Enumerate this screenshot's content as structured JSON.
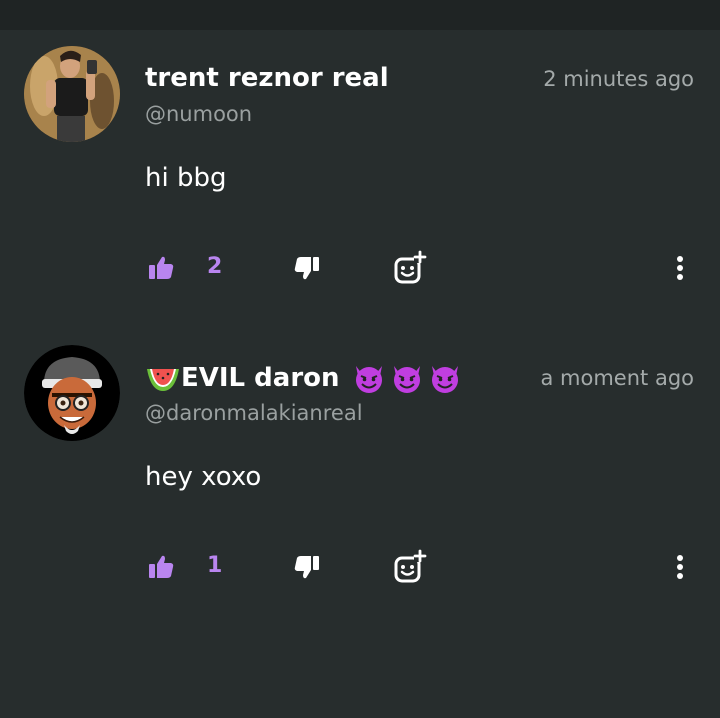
{
  "comments": [
    {
      "author": "trent reznor real",
      "handle": "@numoon",
      "time": "2 minutes ago",
      "text": "hi bbg",
      "likes": "2",
      "avatar_icon": "person-photo-avatar",
      "name_emojis": []
    },
    {
      "author": "EVIL daron",
      "handle": "@daronmalakianreal",
      "time": "a moment ago",
      "text": "hey xoxo",
      "likes": "1",
      "avatar_icon": "cartoon-memoji-avatar",
      "name_prefix_emoji": "watermelon-icon",
      "name_emojis": [
        "smiling-devil-icon",
        "smiling-devil-icon",
        "smiling-devil-icon"
      ]
    }
  ],
  "colors": {
    "background": "#272d2d",
    "top_strip": "#1f2424",
    "accent": "#b985ef",
    "devil": "#c03ee0",
    "text": "#ffffff",
    "muted": "#9aa0a0"
  },
  "icons": {
    "like": "thumbs-up-icon",
    "dislike": "thumbs-down-icon",
    "react": "add-reaction-icon",
    "more": "more-vertical-icon"
  }
}
